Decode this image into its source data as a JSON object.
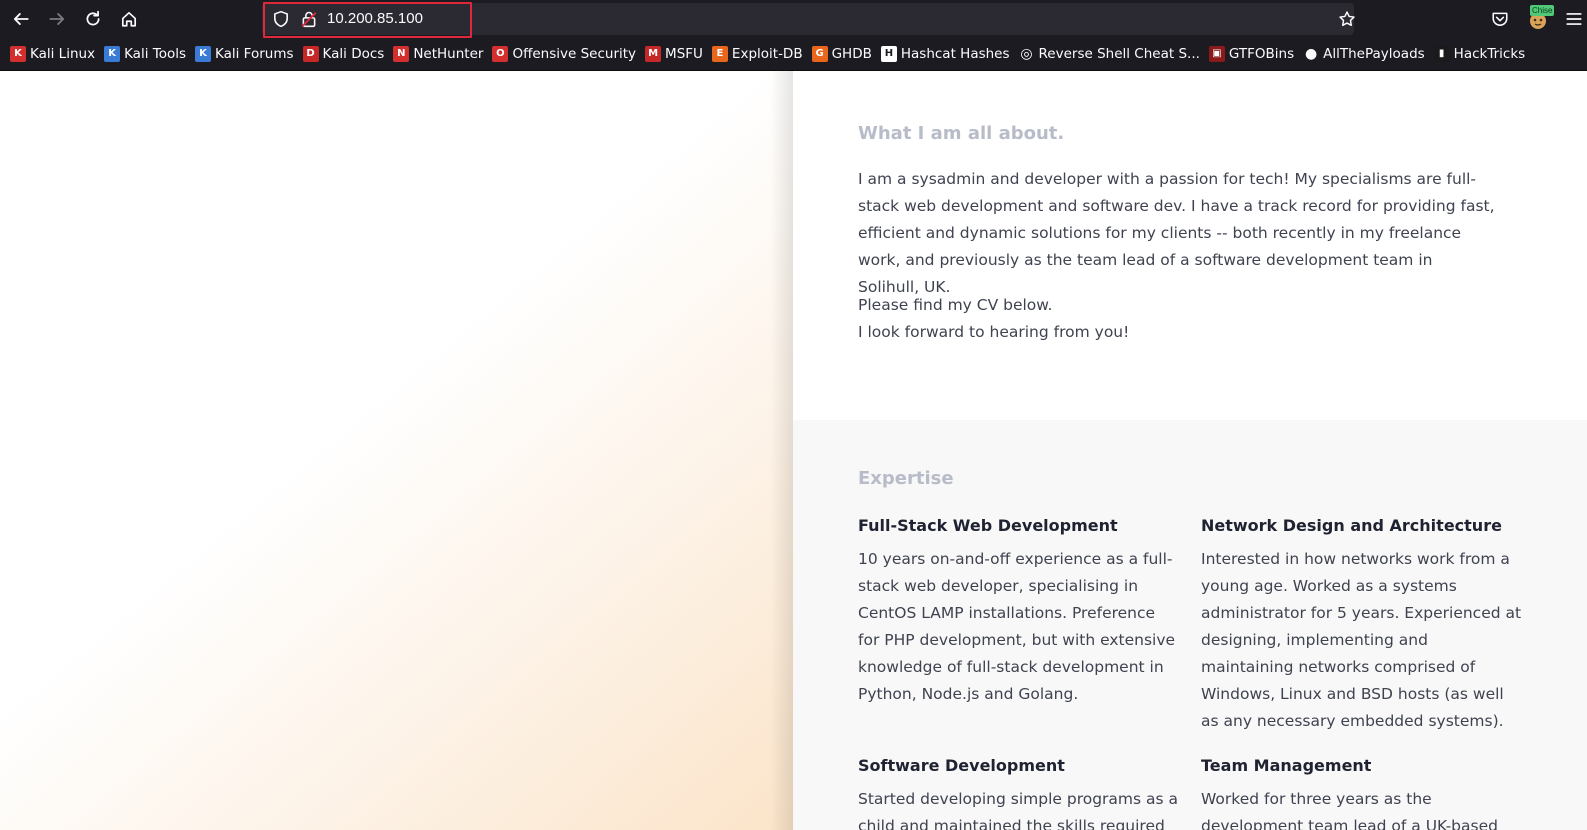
{
  "browser": {
    "url": "10.200.85.100",
    "extension_badge": "Chise",
    "bookmarks": [
      {
        "label": "Kali Linux",
        "icon": "kali-dragon-icon",
        "color": "#d32f2f"
      },
      {
        "label": "Kali Tools",
        "icon": "kali-tools-icon",
        "color": "#3a7bd5"
      },
      {
        "label": "Kali Forums",
        "icon": "kali-forums-icon",
        "color": "#3a7bd5"
      },
      {
        "label": "Kali Docs",
        "icon": "kali-docs-icon",
        "color": "#c62828"
      },
      {
        "label": "NetHunter",
        "icon": "nethunter-icon",
        "color": "#d32f2f"
      },
      {
        "label": "Offensive Security",
        "icon": "offsec-icon",
        "color": "#d32f2f"
      },
      {
        "label": "MSFU",
        "icon": "msfu-icon",
        "color": "#c62828"
      },
      {
        "label": "Exploit-DB",
        "icon": "exploit-db-icon",
        "color": "#e8671c"
      },
      {
        "label": "GHDB",
        "icon": "ghdb-icon",
        "color": "#e8671c"
      },
      {
        "label": "Hashcat Hashes",
        "icon": "hashcat-icon",
        "color": "#ffffff"
      },
      {
        "label": "Reverse Shell Cheat S...",
        "icon": "globe-icon",
        "color": "#fbfbfe"
      },
      {
        "label": "GTFOBins",
        "icon": "gtfobins-icon",
        "color": "#8b1a1a"
      },
      {
        "label": "AllThePayloads",
        "icon": "github-icon",
        "color": "#fbfbfe"
      },
      {
        "label": "HackTricks",
        "icon": "hacktricks-icon",
        "color": "#1a1a1a"
      }
    ]
  },
  "about": {
    "title": "What I am all about.",
    "paragraph1": "I am a sysadmin and developer with a passion for tech! My specialisms are full-stack web development and software dev. I have a track record for providing fast, efficient and dynamic solutions for my clients -- both recently in my freelance work, and previously as the team lead of a software development team in Solihull, UK.",
    "paragraph2_line1": "Please find my CV below.",
    "paragraph2_line2": "I look forward to hearing from you!"
  },
  "expertise": {
    "title": "Expertise",
    "items": [
      {
        "heading": "Full-Stack Web Development",
        "body": "10 years on-and-off experience as a full-stack web developer, specialising in CentOS LAMP installations. Preference for PHP development, but with extensive knowledge of full-stack development in Python, Node.js and Golang."
      },
      {
        "heading": "Network Design and Architecture",
        "body": "Interested in how networks work from a young age. Worked as a systems administrator for 5 years. Experienced at designing, implementing and maintaining networks comprised of Windows, Linux and BSD hosts (as well as any necessary embedded systems)."
      },
      {
        "heading": "Software Development",
        "body": "Started developing simple programs as a child and maintained the skills required"
      },
      {
        "heading": "Team Management",
        "body": "Worked for three years as the development team lead of a UK-based"
      }
    ]
  },
  "colors": {
    "chrome_bg": "#1c1b22",
    "urlbar_bg": "#2b2a33",
    "highlight": "#e0283b",
    "section_title": "#b8bcc8",
    "body_text": "#3f4350",
    "heading_text": "#1f2230",
    "hero_accent": "#fbe4c9"
  }
}
